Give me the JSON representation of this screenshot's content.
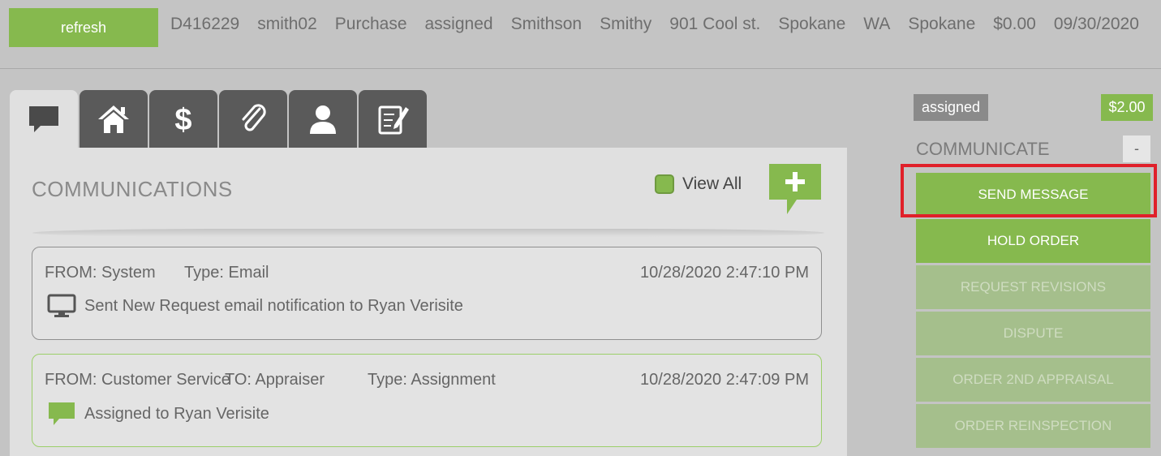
{
  "topbar": {
    "refresh_label": "refresh",
    "fields": [
      "D416229",
      "smith02",
      "Purchase",
      "assigned",
      "Smithson",
      "Smithy",
      "901 Cool st.",
      "Spokane",
      "WA",
      "Spokane",
      "$0.00",
      "09/30/2020"
    ]
  },
  "tabs": [
    {
      "icon": "chat-bubble-icon",
      "active": true
    },
    {
      "icon": "home-icon",
      "active": false
    },
    {
      "icon": "dollar-icon",
      "active": false
    },
    {
      "icon": "paperclip-icon",
      "active": false
    },
    {
      "icon": "person-icon",
      "active": false
    },
    {
      "icon": "notepad-icon",
      "active": false
    }
  ],
  "panel": {
    "title": "COMMUNICATIONS",
    "view_all_label": "View All",
    "add_icon": "add-message-icon"
  },
  "messages": [
    {
      "from": "FROM: System",
      "to": "",
      "type": "Type: Email",
      "date": "10/28/2020 2:47:10 PM",
      "text": "Sent New Request email notification to Ryan Verisite",
      "icon": "monitor-icon"
    },
    {
      "from": "FROM: Customer Service",
      "to": "TO: Appraiser",
      "type": "Type: Assignment",
      "date": "10/28/2020 2:47:09 PM",
      "text": "Assigned to Ryan Verisite",
      "icon": "chat-bubble-icon"
    }
  ],
  "sidebar": {
    "status": "assigned",
    "price": "$2.00",
    "section_title": "COMMUNICATE",
    "collapse_label": "-",
    "actions": [
      {
        "label": "SEND MESSAGE",
        "enabled": true
      },
      {
        "label": "HOLD ORDER",
        "enabled": true
      },
      {
        "label": "REQUEST REVISIONS",
        "enabled": false
      },
      {
        "label": "DISPUTE",
        "enabled": false
      },
      {
        "label": "ORDER 2ND APPRAISAL",
        "enabled": false
      },
      {
        "label": "ORDER REINSPECTION",
        "enabled": false
      }
    ]
  },
  "colors": {
    "accent_green": "#86b94e",
    "highlight_red": "#e0202a",
    "tab_dark": "#5a5a5a"
  }
}
